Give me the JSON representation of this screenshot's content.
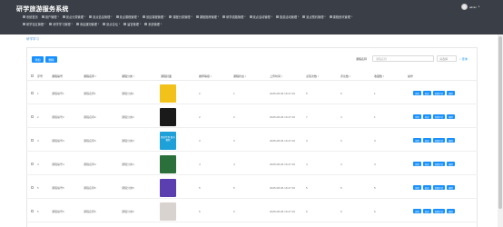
{
  "app_title": "研学旅游服务系统",
  "user": {
    "name": "admin"
  },
  "nav_row1": [
    {
      "label": "系统首页",
      "caret": ""
    },
    {
      "label": "用户管理",
      "caret": "▾"
    },
    {
      "label": "景点分类管理",
      "caret": "▾"
    },
    {
      "label": "景点信息管理",
      "caret": "▾"
    },
    {
      "label": "景点课程管理",
      "caret": "▾"
    },
    {
      "label": "景区课程管理",
      "caret": "▾"
    },
    {
      "label": "课程分类管理",
      "caret": "▾"
    },
    {
      "label": "课程推荐管理",
      "caret": "▾"
    },
    {
      "label": "研学线路管理",
      "caret": "▾"
    },
    {
      "label": "景点活动管理",
      "caret": "▾"
    },
    {
      "label": "旅游活动管理",
      "caret": "▾"
    },
    {
      "label": "景点预约管理",
      "caret": "▾"
    },
    {
      "label": "课程资讯管理",
      "caret": "▾"
    }
  ],
  "nav_row2": [
    {
      "label": "研学社区管理",
      "caret": "▾"
    },
    {
      "label": "研学学习管理",
      "caret": "▾"
    },
    {
      "label": "消息通知管理",
      "caret": "▾"
    },
    {
      "label": "景点论坛",
      "caret": "▾"
    },
    {
      "label": "留言管理",
      "caret": "▾"
    },
    {
      "label": "系统管理",
      "caret": "▾"
    }
  ],
  "breadcrumb": "研学学习",
  "toolbar": {
    "add": "添加",
    "delete": "删除"
  },
  "search": {
    "label": "课程名称",
    "placeholder": "课程名称",
    "select_placeholder": "请选择",
    "button": "查询"
  },
  "table": {
    "headers": [
      "序号",
      "课程编号",
      "课程名称 ↕",
      "课程分类 ↕",
      "课程封面",
      "推荐等级 ↕",
      "课程状态 ↕",
      "上传时间 ↕",
      "点赞次数 ↕",
      "评论数 ↕",
      "收藏数 ↕",
      "操作"
    ],
    "rows": [
      {
        "idx": "1",
        "code": "课程编号1",
        "name": "课程名称1",
        "category": "课程分类1",
        "cover_color": "#f2c21b",
        "cover_text": "",
        "level": "2",
        "status": "1",
        "time": "2025-08-06 16:27:49",
        "likes": "5",
        "comments": "5",
        "favs": "1"
      },
      {
        "idx": "2",
        "code": "课程编号2",
        "name": "课程名称2",
        "category": "课程分类2",
        "cover_color": "#1a1a1a",
        "cover_text": "",
        "level": "2",
        "status": "2",
        "time": "2025-08-06 16:27:49",
        "likes": "7",
        "comments": "4",
        "favs": "1"
      },
      {
        "idx": "3",
        "code": "课程编号3",
        "name": "课程名称3",
        "category": "课程分类3",
        "cover_color": "#1ea0d8",
        "cover_text": "我的世界 数字教程",
        "level": "3",
        "status": "3",
        "time": "2025-08-06 16:27:49",
        "likes": "3",
        "comments": "3",
        "favs": "3"
      },
      {
        "idx": "4",
        "code": "课程编号4",
        "name": "课程名称4",
        "category": "课程分类4",
        "cover_color": "#2b6f3a",
        "cover_text": "",
        "level": "4",
        "status": "4",
        "time": "2025-08-06 16:27:49",
        "likes": "4",
        "comments": "4",
        "favs": "4"
      },
      {
        "idx": "5",
        "code": "课程编号5",
        "name": "课程名称5",
        "category": "课程分类5",
        "cover_color": "#5b3fb0",
        "cover_text": "",
        "level": "5",
        "status": "5",
        "time": "2025-08-06 16:27:49",
        "likes": "5",
        "comments": "5",
        "favs": "5"
      },
      {
        "idx": "6",
        "code": "课程编号6",
        "name": "课程名称6",
        "category": "课程分类6",
        "cover_color": "#d8d3cf",
        "cover_text": "",
        "level": "6",
        "status": "6",
        "time": "2025-08-06 16:27:49",
        "likes": "6",
        "comments": "6",
        "favs": "6"
      }
    ],
    "ops": [
      "详情",
      "修改",
      "查看评论",
      "删除"
    ]
  },
  "colors": {
    "header_bg": "#3a3f47",
    "primary": "#1890ff",
    "link": "#5b9bd5"
  }
}
